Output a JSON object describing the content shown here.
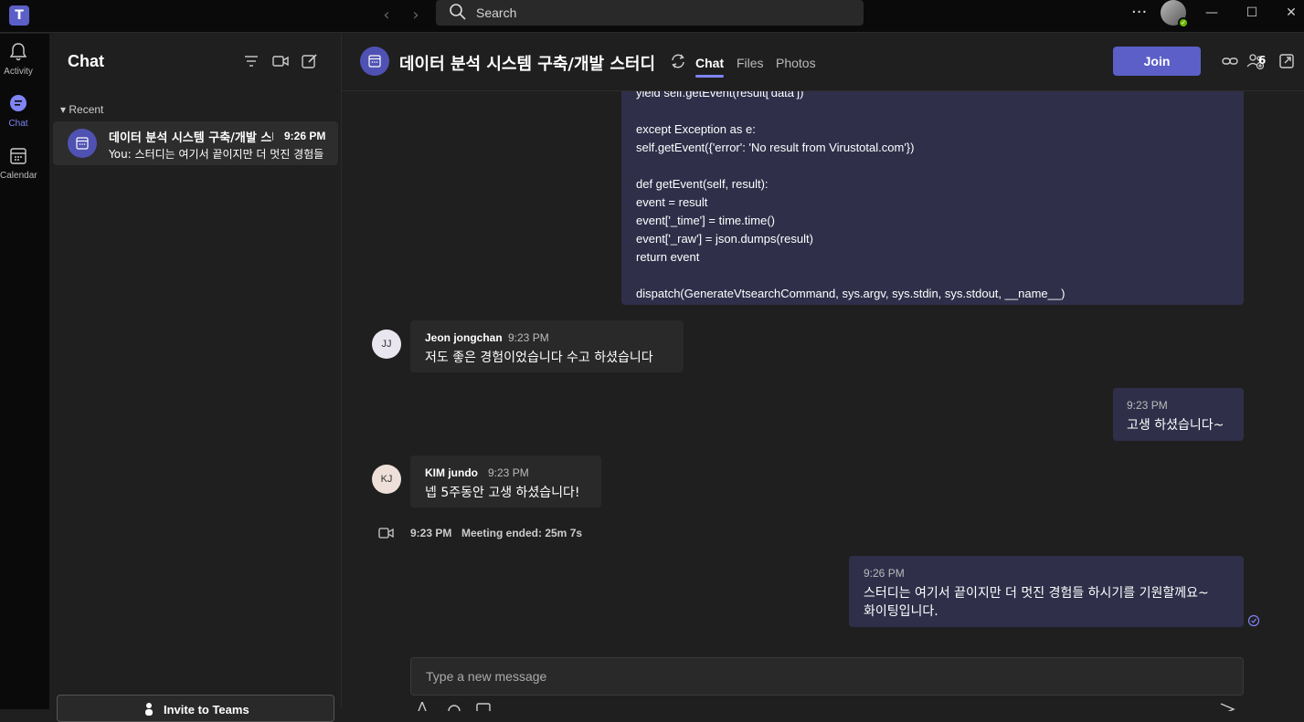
{
  "titlebar": {
    "search_placeholder": "Search",
    "more": "···",
    "back": "‹",
    "forward": "›"
  },
  "rail": [
    {
      "label": "Activity",
      "icon": "bell-icon"
    },
    {
      "label": "Chat",
      "icon": "chat-icon"
    },
    {
      "label": "Calendar",
      "icon": "calendar-icon"
    }
  ],
  "sidebar": {
    "title": "Chat",
    "section": "Recent",
    "chat_item": {
      "name": "데이터 분석 시스템 구축/개발 스터디",
      "time": "9:26 PM",
      "preview": "You: 스터디는 여기서 끝이지만 더 멋진 경험들 하시기를 기원할께요~ 화이팅입니다."
    },
    "invite_label": "Invite to Teams"
  },
  "header": {
    "title": "데이터 분석 시스템 구축/개발 스터디",
    "tabs": [
      "Chat",
      "Files",
      "Photos"
    ],
    "join_label": "Join",
    "participant_count": "6"
  },
  "code_block": {
    "lines": [
      "yield self.getEvent(result['data'])",
      "",
      "except Exception as e:",
      "self.getEvent({'error': 'No result from Virustotal.com'})",
      "",
      "def getEvent(self, result):",
      "event = result",
      "event['_time'] = time.time()",
      "event['_raw'] = json.dumps(result)",
      "return event",
      "",
      "dispatch(GenerateVtsearchCommand, sys.argv, sys.stdin, sys.stdout, __name__)"
    ]
  },
  "messages": [
    {
      "type": "in",
      "initials": "JJ",
      "author": "Jeon jongchan",
      "time": "9:23 PM",
      "text": "저도 좋은 경험이었습니다 수고 하셨습니다"
    },
    {
      "type": "out",
      "time": "9:23 PM",
      "text": "고생 하셨습니다~"
    },
    {
      "type": "in",
      "initials": "KJ",
      "author": "KIM jundo",
      "time": "9:23 PM",
      "text": "넵 5주동안 고생 하셨습니다!"
    },
    {
      "type": "out",
      "time": "9:26 PM",
      "text_line1": "스터디는 여기서 끝이지만 더 멋진 경험들 하시기를 기원할께요~",
      "text_line2": "화이팅입니다."
    }
  ],
  "meeting_event": {
    "time": "9:23 PM",
    "text": "Meeting ended: 25m 7s"
  },
  "composer": {
    "placeholder": "Type a new message"
  }
}
